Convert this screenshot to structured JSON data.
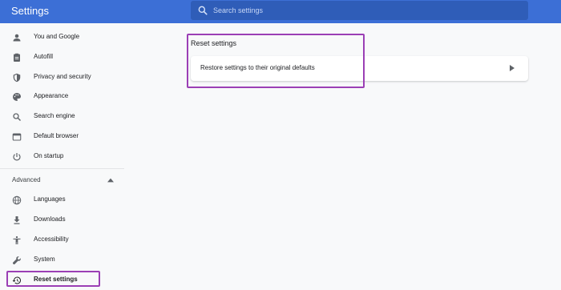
{
  "header": {
    "title": "Settings",
    "search_placeholder": "Search settings"
  },
  "sidebar": {
    "items": [
      {
        "label": "You and Google",
        "icon": "person-icon"
      },
      {
        "label": "Autofill",
        "icon": "clipboard-icon"
      },
      {
        "label": "Privacy and security",
        "icon": "shield-icon"
      },
      {
        "label": "Appearance",
        "icon": "palette-icon"
      },
      {
        "label": "Search engine",
        "icon": "search-icon"
      },
      {
        "label": "Default browser",
        "icon": "browser-icon"
      },
      {
        "label": "On startup",
        "icon": "power-icon"
      }
    ],
    "advanced_label": "Advanced",
    "advanced_items": [
      {
        "label": "Languages",
        "icon": "globe-icon"
      },
      {
        "label": "Downloads",
        "icon": "download-icon"
      },
      {
        "label": "Accessibility",
        "icon": "accessibility-icon"
      },
      {
        "label": "System",
        "icon": "wrench-icon"
      },
      {
        "label": "Reset settings",
        "icon": "history-icon"
      }
    ]
  },
  "main": {
    "section_title": "Reset settings",
    "restore_label": "Restore settings to their original defaults"
  },
  "colors": {
    "header": "#3c6fd6",
    "highlight": "#9b3fb5",
    "background": "#f8f9fa"
  }
}
